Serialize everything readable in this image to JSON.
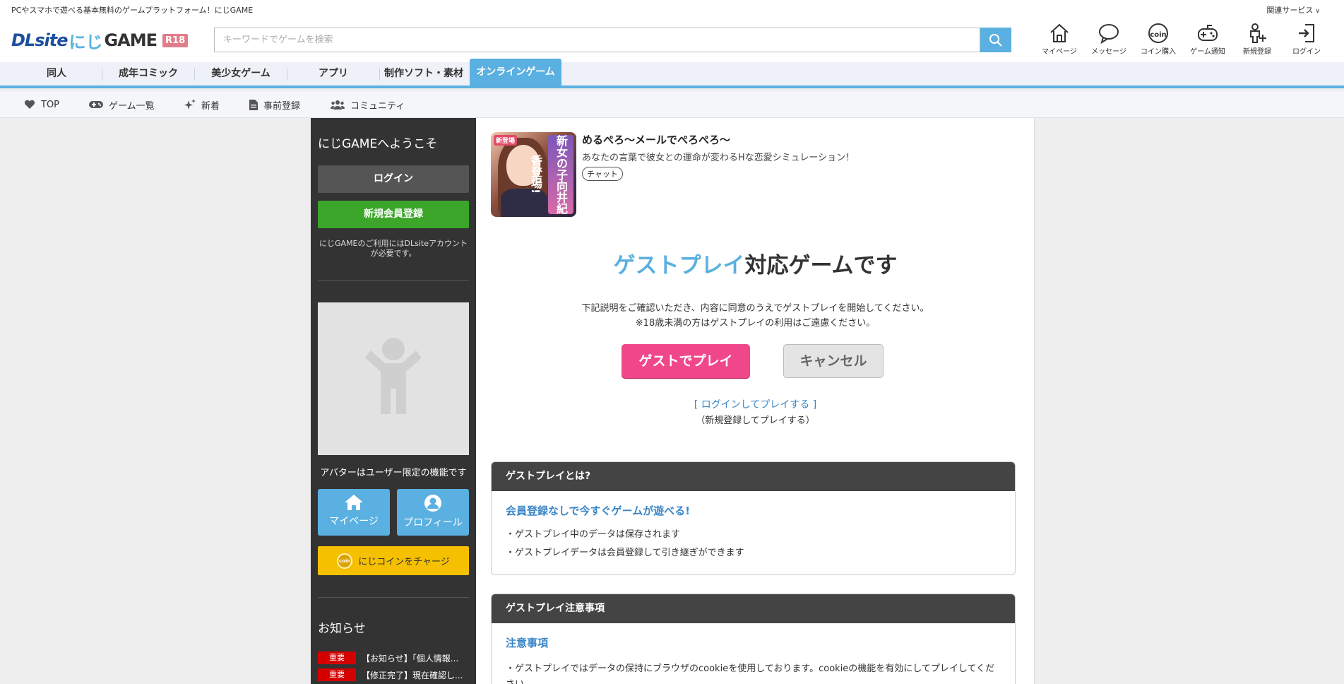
{
  "header": {
    "tagline": "PCやスマホで遊べる基本無料のゲームプラットフォーム！にじGAME",
    "related_services": "関連サービス",
    "logo_dl": "DLsite",
    "logo_niji": "にじ",
    "logo_game": "GAME",
    "logo_badge": "R18",
    "search_placeholder": "キーワードでゲームを検索",
    "icon_nav": [
      {
        "label": "マイページ",
        "icon": "home-icon"
      },
      {
        "label": "メッセージ",
        "icon": "message-icon"
      },
      {
        "label": "コイン購入",
        "icon": "coin-icon"
      },
      {
        "label": "ゲーム通知",
        "icon": "gamepad-icon"
      },
      {
        "label": "新規登録",
        "icon": "register-icon"
      },
      {
        "label": "ログイン",
        "icon": "login-icon"
      }
    ]
  },
  "categories": [
    "同人",
    "成年コミック",
    "美少女ゲーム",
    "アプリ",
    "制作ソフト・素材",
    "オンラインゲーム"
  ],
  "active_category": "オンラインゲーム",
  "subnav": [
    {
      "label": "TOP",
      "icon": "heart-icon"
    },
    {
      "label": "ゲーム一覧",
      "icon": "gamepad-icon"
    },
    {
      "label": "新着",
      "icon": "sparkle-icon"
    },
    {
      "label": "事前登録",
      "icon": "document-icon"
    },
    {
      "label": "コミュニティ",
      "icon": "users-icon"
    }
  ],
  "sidebar": {
    "welcome": "にじGAMEへようこそ",
    "login": "ログイン",
    "register": "新規会員登録",
    "note": "にじGAMEのご利用にはDLsiteアカウントが必要です。",
    "avatar_note": "アバターはユーザー限定の機能です",
    "mypage": "マイページ",
    "profile": "プロフィール",
    "coin_charge": "にじコインをチャージ",
    "coin_label": "coin",
    "news_title": "お知らせ",
    "news": [
      {
        "badge": "重要",
        "text": "【お知らせ】「個人情報..."
      },
      {
        "badge": "重要",
        "text": "【修正完了】現在確認し..."
      }
    ]
  },
  "game": {
    "title": "めるぺろ～メールでぺろぺろ～",
    "description": "あなたの言葉で彼女との運命が変わるHな恋愛シミュレーション！",
    "tag": "チャット",
    "thumb_text": "新女の子向井紀香登場!",
    "thumb_badge": "新登場"
  },
  "main": {
    "headline_accent": "ゲストプレイ",
    "headline_rest": "対応ゲームです",
    "message_line1": "下記説明をご確認いただき、内容に同意のうえでゲストプレイを開始してください。",
    "message_line2": "※18歳未満の方はゲストプレイの利用はご遠慮ください。",
    "guest_button": "ゲストでプレイ",
    "cancel_button": "キャンセル",
    "login_link": "[ ログインしてプレイする ]",
    "register_link": "（新規登録してプレイする）"
  },
  "panel_about": {
    "heading": "ゲストプレイとは?",
    "subheading": "会員登録なしで今すぐゲームが遊べる!",
    "items": [
      "・ゲストプレイ中のデータは保存されます",
      "・ゲストプレイデータは会員登録して引き継ぎができます"
    ]
  },
  "panel_notes": {
    "heading": "ゲストプレイ注意事項",
    "subheading": "注意事項",
    "items": [
      "・ゲストプレイではデータの保持にブラウザのcookieを使用しております。cookieの機能を有効にしてプレイしてください。"
    ]
  },
  "colors": {
    "accent_blue": "#5ab0e0",
    "pink": "#f0478a",
    "green": "#3ba62a",
    "coin_yellow": "#f5c000",
    "badge_red": "#d40000"
  }
}
